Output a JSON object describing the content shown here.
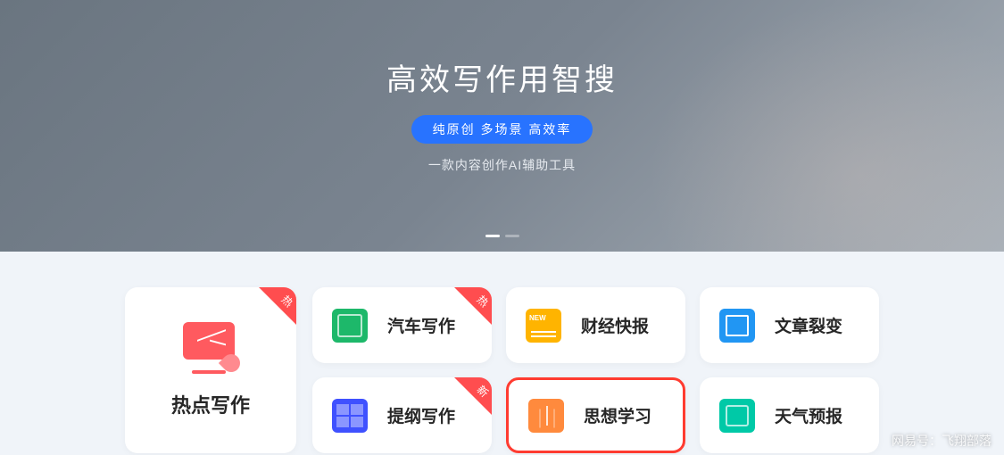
{
  "hero": {
    "title": "高效写作用智搜",
    "pill": "纯原创 多场景 高效率",
    "subtitle": "一款内容创作AI辅助工具"
  },
  "featured": {
    "badge": "热",
    "label": "热点写作"
  },
  "cards": [
    {
      "label": "汽车写作",
      "badge": "热"
    },
    {
      "label": "财经快报",
      "badge": null
    },
    {
      "label": "文章裂变",
      "badge": null
    },
    {
      "label": "提纲写作",
      "badge": "新"
    },
    {
      "label": "思想学习",
      "badge": null
    },
    {
      "label": "天气预报",
      "badge": null
    }
  ],
  "watermark": "网易号：飞翔部落"
}
